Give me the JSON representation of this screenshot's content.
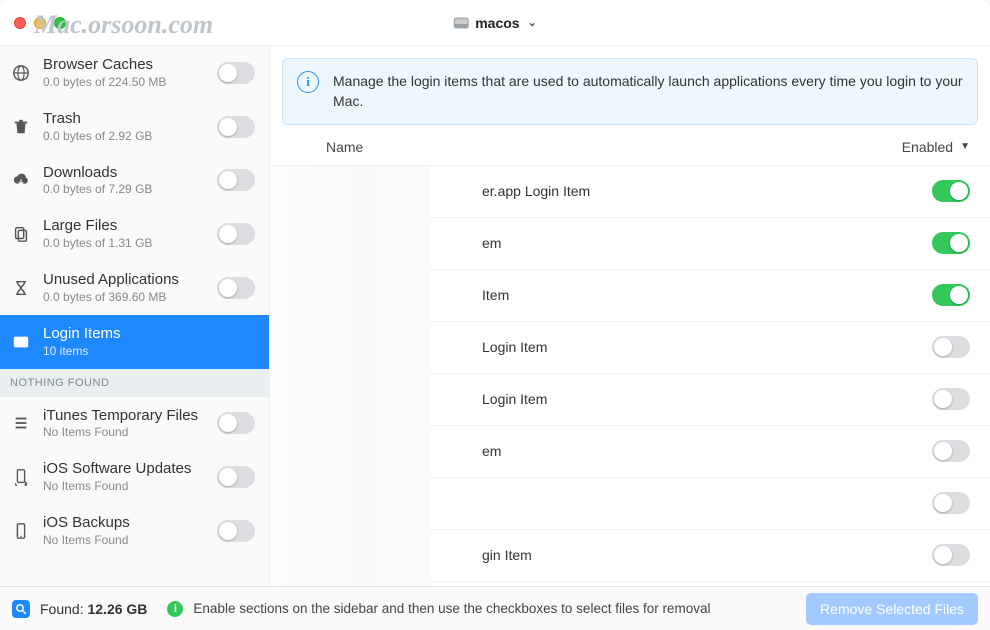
{
  "titlebar": {
    "disk_name": "macos"
  },
  "watermark": "Mac.orsoon.com",
  "sidebar": {
    "items": [
      {
        "title": "Browser Caches",
        "sub": "0.0 bytes of 224.50 MB",
        "icon": "globe",
        "has_toggle": true
      },
      {
        "title": "Trash",
        "sub": "0.0 bytes of 2.92 GB",
        "icon": "trash",
        "has_toggle": true
      },
      {
        "title": "Downloads",
        "sub": "0.0 bytes of 7.29 GB",
        "icon": "cloud-down",
        "has_toggle": true
      },
      {
        "title": "Large Files",
        "sub": "0.0 bytes of 1.31 GB",
        "icon": "copy",
        "has_toggle": true
      },
      {
        "title": "Unused Applications",
        "sub": "0.0 bytes of 369.60 MB",
        "icon": "hourglass",
        "has_toggle": true
      },
      {
        "title": "Login Items",
        "sub": "10 items",
        "icon": "user-card",
        "selected": true
      }
    ],
    "nothing_found_header": "NOTHING FOUND",
    "nothing_found_items": [
      {
        "title": "iTunes Temporary Files",
        "sub": "No Items Found",
        "icon": "list"
      },
      {
        "title": "iOS Software Updates",
        "sub": "No Items Found",
        "icon": "sync-phone"
      },
      {
        "title": "iOS Backups",
        "sub": "No Items Found",
        "icon": "phone"
      }
    ]
  },
  "main": {
    "info_text": "Manage the login items that are used to automatically launch applications every time you login to your Mac.",
    "header_name": "Name",
    "header_enabled": "Enabled",
    "rows": [
      {
        "name": "er.app Login Item",
        "enabled": true
      },
      {
        "name": "em",
        "enabled": true
      },
      {
        "name": "Item",
        "enabled": true
      },
      {
        "name": " Login Item",
        "enabled": false
      },
      {
        "name": " Login Item",
        "enabled": false
      },
      {
        "name": "em",
        "enabled": false
      },
      {
        "name": "",
        "enabled": false
      },
      {
        "name": "gin Item",
        "enabled": false
      },
      {
        "name": ".",
        "enabled": false
      }
    ]
  },
  "footer": {
    "found_label": "Found:",
    "found_value": "12.26 GB",
    "tip": "Enable sections on the sidebar and then use the checkboxes to select files for removal",
    "remove_label": "Remove Selected Files"
  }
}
